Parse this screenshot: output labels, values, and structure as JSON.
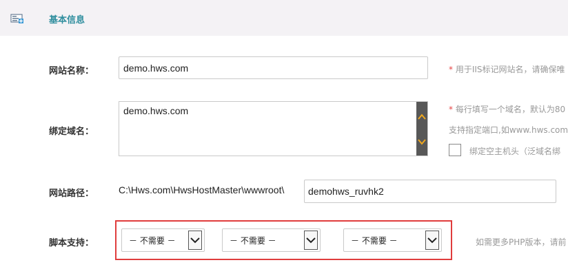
{
  "header": {
    "title": "基本信息",
    "icon": "info-card-icon"
  },
  "site_name": {
    "label": "网站名称：",
    "value": "demo.hws.com",
    "hint_required": "*",
    "hint": " 用于IIS标记网站名，请确保唯"
  },
  "bind_domain": {
    "label": "绑定域名：",
    "value": "demo.hws.com",
    "hint_required": "*",
    "hint_line1": " 每行填写一个域名，默认为80",
    "hint_line2": "支持指定端口,如www.hws.com",
    "checkbox_label": "绑定空主机头（泛域名绑"
  },
  "site_path": {
    "label": "网站路径：",
    "prefix": "C:\\Hws.com\\HwsHostMaster\\wwwroot\\",
    "value": "demohws_ruvhk2"
  },
  "script_support": {
    "label": "脚本支持：",
    "selects": [
      {
        "value": "－ 不需要 －"
      },
      {
        "value": "－ 不需要 －"
      },
      {
        "value": "－ 不需要 －"
      }
    ],
    "hint": "如需更多PHP版本，请前"
  },
  "colors": {
    "header_bg": "#f4f2f5",
    "header_title": "#2f8e9e",
    "required_star": "#e64646",
    "highlight_border": "#e03c3c",
    "scrollbar": "#585858",
    "scroll_arrow": "#f0a81e"
  }
}
